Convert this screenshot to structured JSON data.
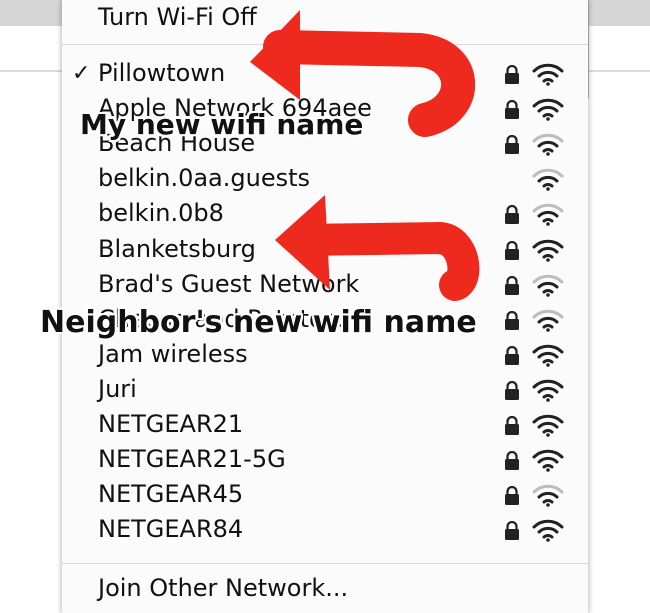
{
  "menu": {
    "top_item": {
      "label": "Turn Wi-Fi Off"
    },
    "connected_check": "✓",
    "networks": [
      {
        "name": "Pillowtown",
        "selected": true,
        "locked": true,
        "signal_bars": 3
      },
      {
        "name": "Apple Network 694aee",
        "selected": false,
        "locked": true,
        "signal_bars": 3
      },
      {
        "name": "Beach House",
        "selected": false,
        "locked": true,
        "signal_bars": 2
      },
      {
        "name": "belkin.0aa.guests",
        "selected": false,
        "locked": false,
        "signal_bars": 2
      },
      {
        "name": "belkin.0b8",
        "selected": false,
        "locked": true,
        "signal_bars": 2
      },
      {
        "name": "Blanketsburg",
        "selected": false,
        "locked": true,
        "signal_bars": 3
      },
      {
        "name": "Brad's Guest Network",
        "selected": false,
        "locked": true,
        "signal_bars": 2
      },
      {
        "name": "Cheese and Potatoes",
        "selected": false,
        "locked": true,
        "signal_bars": 2
      },
      {
        "name": "Jam wireless",
        "selected": false,
        "locked": true,
        "signal_bars": 3
      },
      {
        "name": "Juri",
        "selected": false,
        "locked": true,
        "signal_bars": 3
      },
      {
        "name": "NETGEAR21",
        "selected": false,
        "locked": true,
        "signal_bars": 3
      },
      {
        "name": "NETGEAR21-5G",
        "selected": false,
        "locked": true,
        "signal_bars": 3
      },
      {
        "name": "NETGEAR45",
        "selected": false,
        "locked": true,
        "signal_bars": 2
      },
      {
        "name": "NETGEAR84",
        "selected": false,
        "locked": true,
        "signal_bars": 3
      }
    ],
    "bottom_item": {
      "label": "Join Other Network..."
    }
  },
  "annotations": {
    "label_1": "My new wifi name",
    "label_2": "Neighbor's new wifi name",
    "arrow_color": "#ee2a1f"
  },
  "colors": {
    "menu_background": "#fbfbfb",
    "text": "#111111",
    "icon": "#222222",
    "icon_faint": "#bdbdbd"
  },
  "icons": {
    "lock": "lock-icon",
    "wifi": "wifi-signal-icon",
    "check": "checkmark-icon"
  }
}
